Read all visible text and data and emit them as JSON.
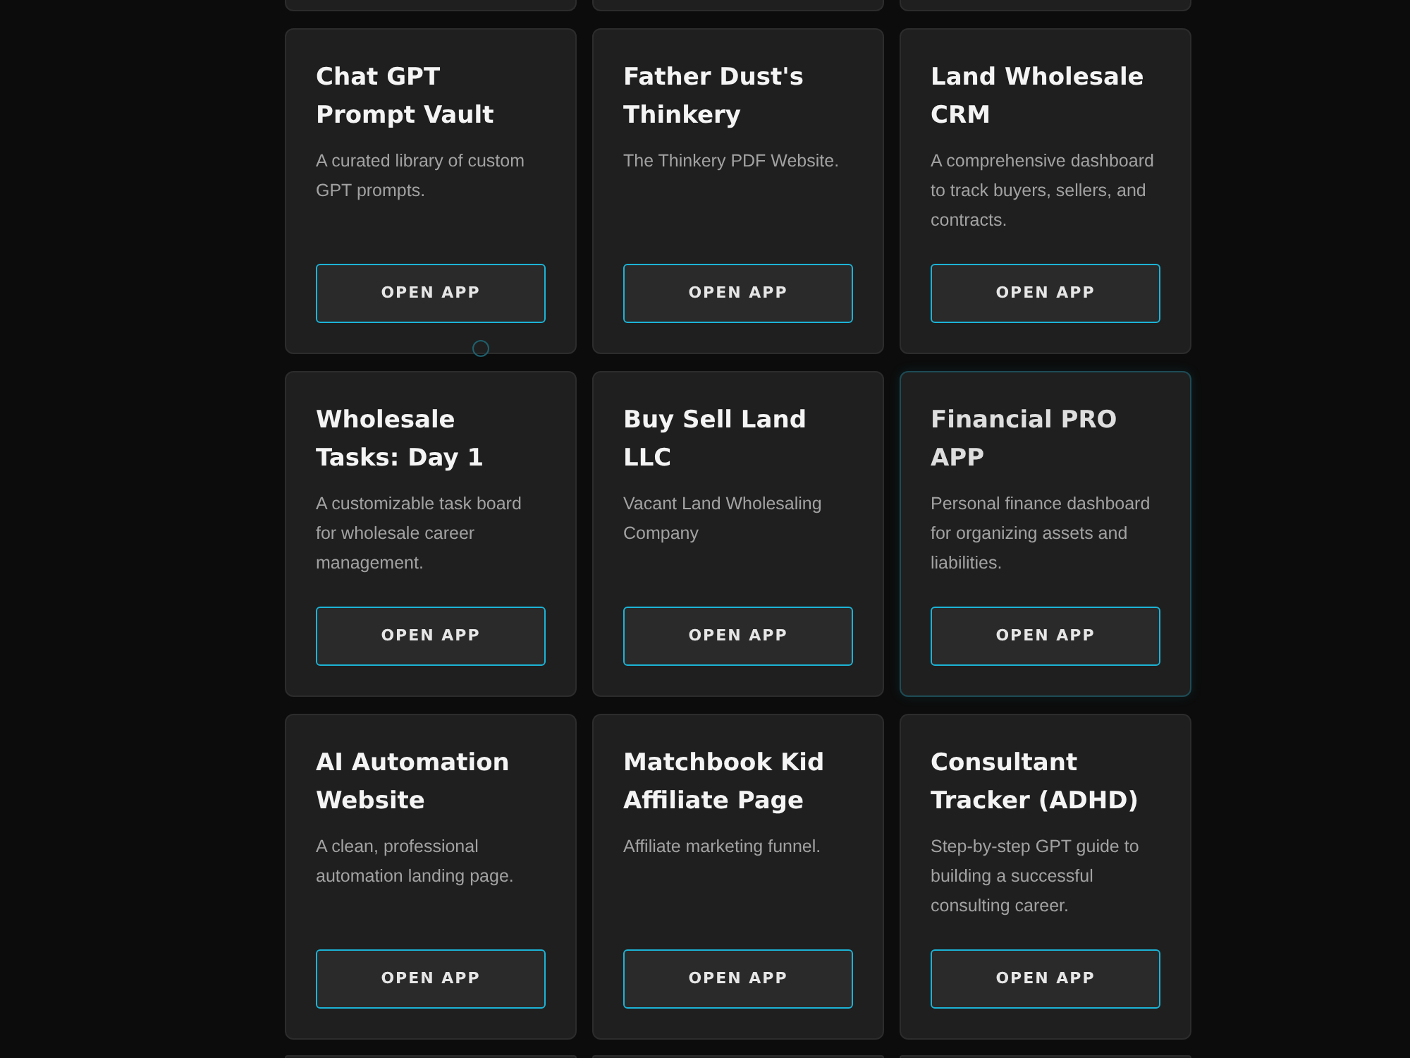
{
  "cards": [
    {
      "title": "Chat GPT Prompt Vault",
      "description": "A curated library of custom GPT prompts.",
      "button": "OPEN APP",
      "hovered": false
    },
    {
      "title": "Father Dust's Thinkery",
      "description": "The Thinkery PDF Website.",
      "button": "OPEN APP",
      "hovered": false
    },
    {
      "title": "Land Wholesale CRM",
      "description": "A comprehensive dashboard to track buyers, sellers, and contracts.",
      "button": "OPEN APP",
      "hovered": false
    },
    {
      "title": "Wholesale Tasks: Day 1",
      "description": "A customizable task board for wholesale career management.",
      "button": "OPEN APP",
      "hovered": false
    },
    {
      "title": "Buy Sell Land LLC",
      "description": "Vacant Land Wholesaling Company",
      "button": "OPEN APP",
      "hovered": false
    },
    {
      "title": "Financial PRO APP",
      "description": "Personal finance dashboard for organizing assets and liabilities.",
      "button": "OPEN APP",
      "hovered": true
    },
    {
      "title": "AI Automation Website",
      "description": "A clean, professional automation landing page.",
      "button": "OPEN APP",
      "hovered": false
    },
    {
      "title": "Matchbook Kid Affiliate Page",
      "description": "Affiliate marketing funnel.",
      "button": "OPEN APP",
      "hovered": false
    },
    {
      "title": "Consultant Tracker (ADHD)",
      "description": "Step-by-step GPT guide to building a successful consulting career.",
      "button": "OPEN APP",
      "hovered": false
    }
  ]
}
